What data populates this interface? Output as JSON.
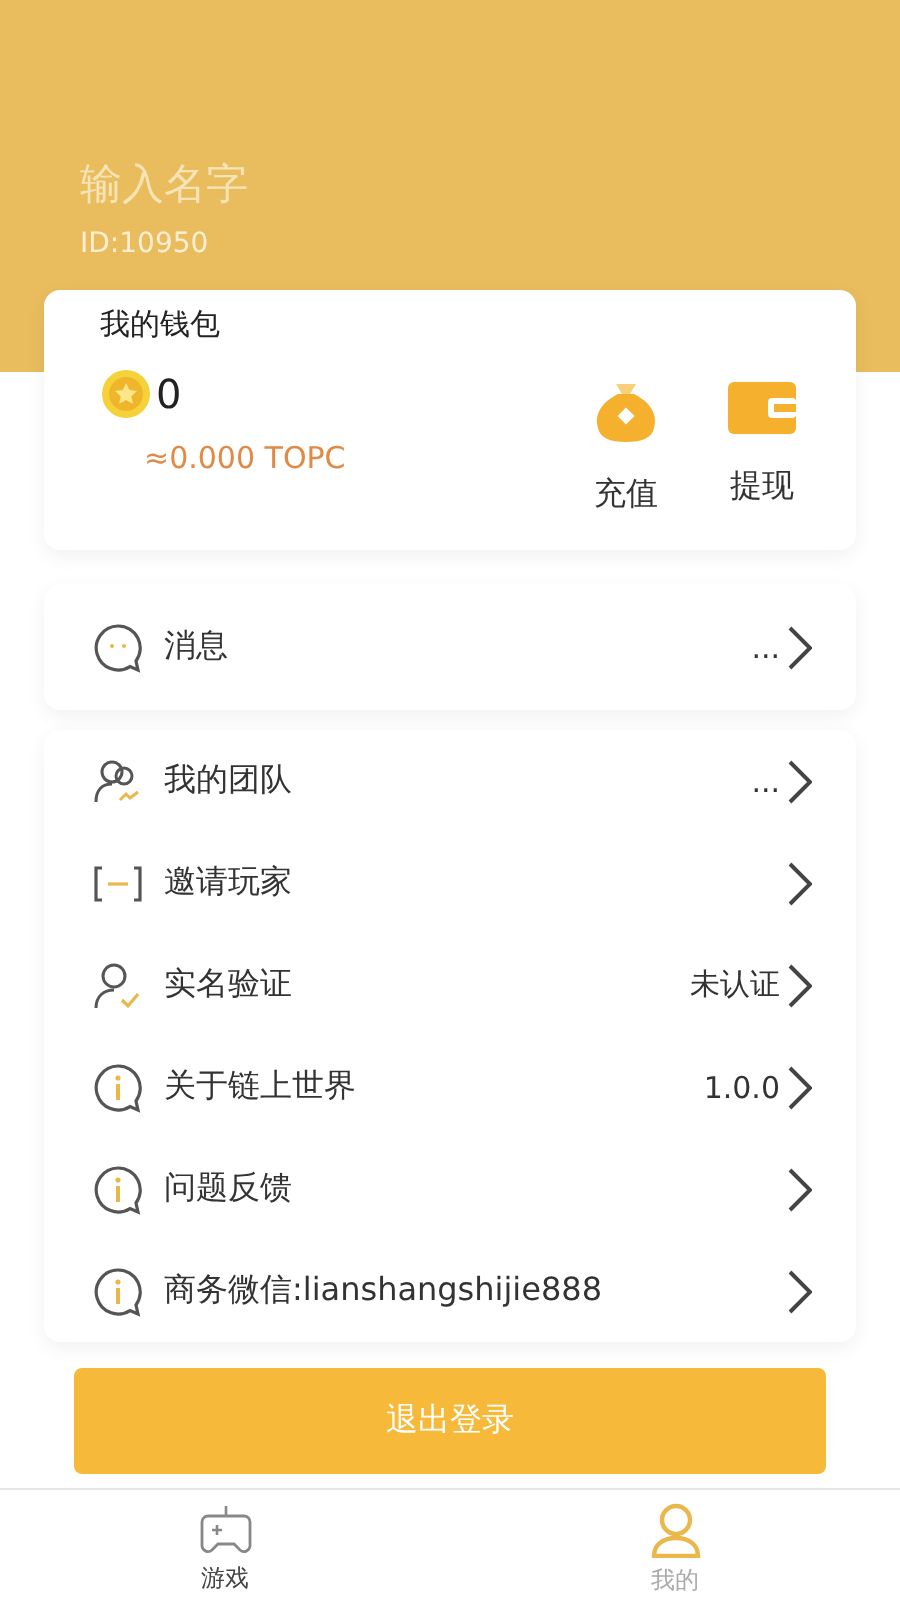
{
  "profile": {
    "name_placeholder": "输入名字",
    "id": "ID:10950"
  },
  "wallet": {
    "title": "我的钱包",
    "balance": "0",
    "converted": "≈0.000 TOPC",
    "actions": [
      {
        "kind": "bag",
        "label": "充值"
      },
      {
        "kind": "wallet",
        "label": "提现"
      }
    ]
  },
  "message_item": {
    "kind": "chat",
    "label": "消息",
    "value": "..."
  },
  "menu_items": [
    {
      "kind": "team",
      "label": "我的团队",
      "value": "..."
    },
    {
      "kind": "invite",
      "label": "邀请玩家"
    },
    {
      "kind": "verify",
      "label": "实名验证",
      "value": "未认证"
    },
    {
      "kind": "info",
      "label": "关于链上世界",
      "value": "1.0.0"
    },
    {
      "kind": "info",
      "label": "问题反馈"
    },
    {
      "kind": "info",
      "label": "商务微信:lianshangshijie888"
    }
  ],
  "logout_button": "退出登录",
  "tabs": [
    {
      "kind": "game",
      "label": "游戏",
      "selected": false
    },
    {
      "kind": "user",
      "label": "我的",
      "selected": true
    }
  ]
}
